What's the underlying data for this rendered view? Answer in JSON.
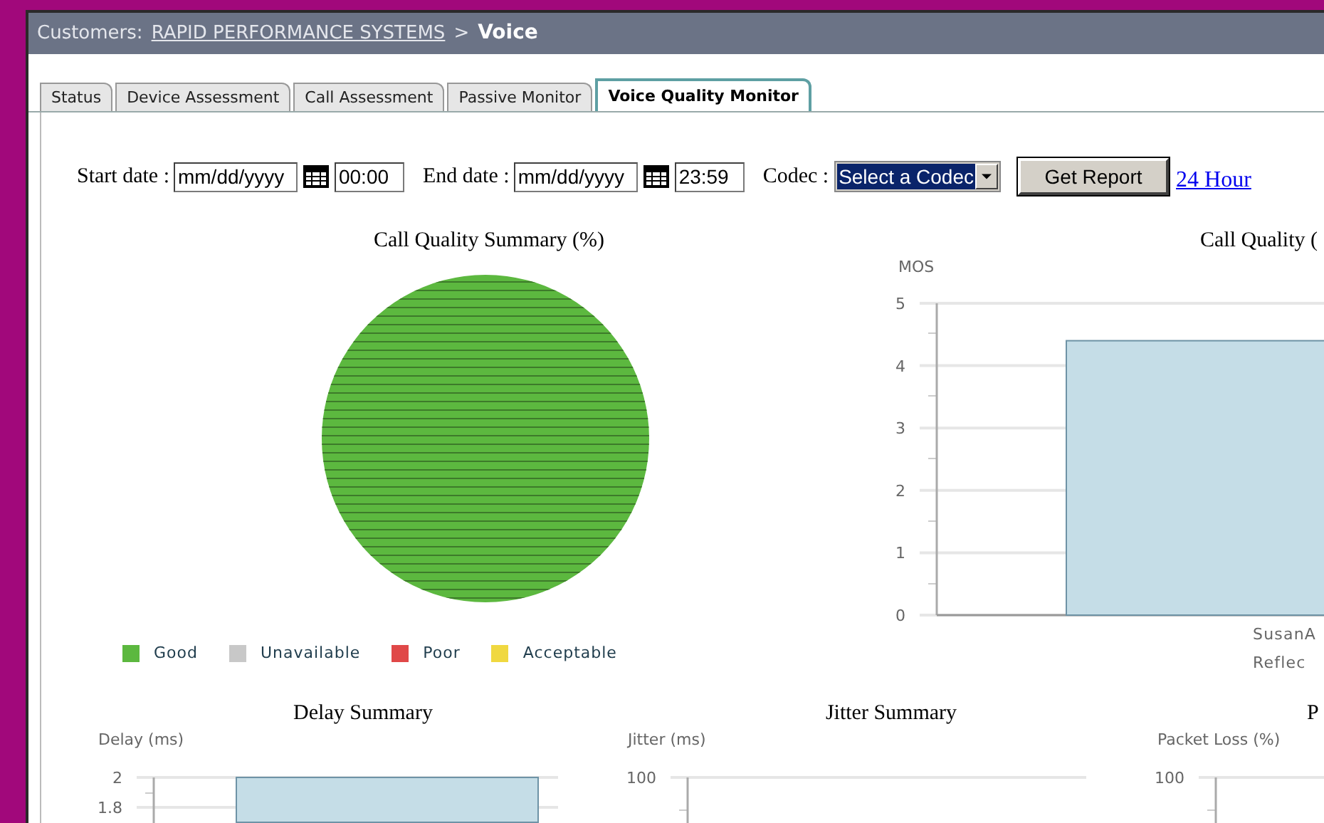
{
  "breadcrumb": {
    "label": "Customers:",
    "customer": "RAPID PERFORMANCE SYSTEMS",
    "separator": ">",
    "page": "Voice"
  },
  "tabs": [
    {
      "label": "Status",
      "selected": false
    },
    {
      "label": "Device Assessment",
      "selected": false
    },
    {
      "label": "Call Assessment",
      "selected": false
    },
    {
      "label": "Passive Monitor",
      "selected": false
    },
    {
      "label": "Voice Quality Monitor",
      "selected": true
    }
  ],
  "filters": {
    "start_label": "Start date :",
    "start_date": "mm/dd/yyyy",
    "start_time": "00:00",
    "end_label": "End date :",
    "end_date": "mm/dd/yyyy",
    "end_time": "23:59",
    "codec_label": "Codec :",
    "codec": "Select a Codec",
    "button": "Get Report",
    "link": "24 Hour"
  },
  "summary_chart": {
    "chart_data": {
      "type": "pie",
      "title": "Call Quality Summary (%)",
      "values": [
        100
      ]
    },
    "legend": [
      {
        "label": "Good",
        "color": "#5cb83f"
      },
      {
        "label": "Unavailable",
        "color": "#c8c8c8"
      },
      {
        "label": "Poor",
        "color": "#e04848"
      },
      {
        "label": "Acceptable",
        "color": "#f0d840"
      }
    ]
  },
  "mos_chart": {
    "chart_data": {
      "type": "bar",
      "title": "Call Quality (",
      "ylabel": "MOS",
      "categories": [
        "SusanA Reflec"
      ],
      "values": [
        4.4
      ],
      "ylim": [
        0,
        5
      ],
      "yticks": [
        0,
        1,
        2,
        3,
        4,
        5
      ],
      "grid": true
    }
  },
  "bottom_charts": [
    {
      "kind": "chart",
      "chart_data": {
        "type": "bar",
        "title": "Delay Summary",
        "ylabel": "Delay (ms)",
        "values": [
          2
        ],
        "ylim": [
          1.7,
          2
        ],
        "yticks": [
          1.8,
          2
        ],
        "grid": true
      }
    },
    {
      "kind": "axis",
      "title": "Jitter Summary",
      "ylabel": "Jitter (ms)",
      "tick_labels": [
        "100"
      ]
    },
    {
      "kind": "axis",
      "title": "P",
      "ylabel": "Packet Loss (%)",
      "tick_labels": [
        "100"
      ]
    }
  ]
}
